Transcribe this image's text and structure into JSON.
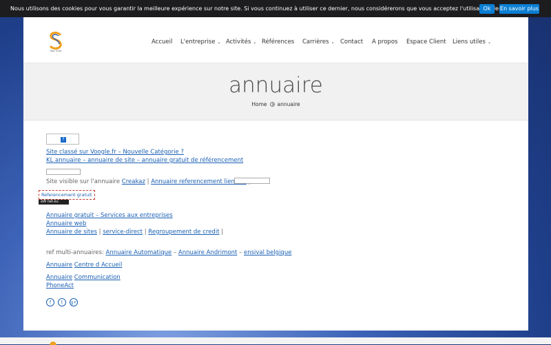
{
  "cookie": {
    "text": "Nous utilisons des cookies pour vous garantir la meilleure expérience sur notre site. Si vous continuez à utiliser ce dernier, nous considérerons que vous acceptez l'utilisation des cookies.",
    "ok": "Ok",
    "more": "En savoir plus"
  },
  "logo": {
    "text": "Sacr Euro"
  },
  "nav": [
    {
      "label": "Accueil"
    },
    {
      "label": "L'entreprise"
    },
    {
      "label": "Activités"
    },
    {
      "label": "Références"
    },
    {
      "label": "Carrières"
    },
    {
      "label": "Contact"
    },
    {
      "label": "A propos"
    },
    {
      "label": "Espace Client"
    },
    {
      "label": "Liens utiles"
    }
  ],
  "page": {
    "title": "annuaire",
    "breadcrumb": {
      "home": "Home",
      "current": "annuaire"
    }
  },
  "content": {
    "link1": "Site classé sur Voogle.fr – Nouvelle Catégorie ?",
    "link2": "KL annuaire – annuaire de site – annuaire gratuit de référencement",
    "visible_prefix": "Site visible sur l'annuaire",
    "creakaz": "Creakaz",
    "sep": "|",
    "annuaire_ref": "Annuaire referencement lien dur",
    "ref_gratuit": "Referencement gratuit",
    "badge": "net.eu",
    "link_services": "Annuaire gratuit – Services aux entreprises",
    "link_web": "Annuaire web",
    "link_sites": "Annuaire de sites",
    "link_service_direct": "service-direct",
    "link_regroupement": "Regroupement de credit",
    "multi_prefix": "ref multi-annuaires:",
    "multi_auto": "Annuaire Automatique",
    "dash": "–",
    "multi_andrimont": "Annuaire Andrimont",
    "multi_ensival": "ensival belgique",
    "annuaire_word": "Annuaire",
    "centre": "Centre d Accueil",
    "communication": "Communication",
    "phoneact": "PhoneAct"
  },
  "social": {
    "facebook": "f",
    "twitter": "t",
    "google": "g+"
  }
}
